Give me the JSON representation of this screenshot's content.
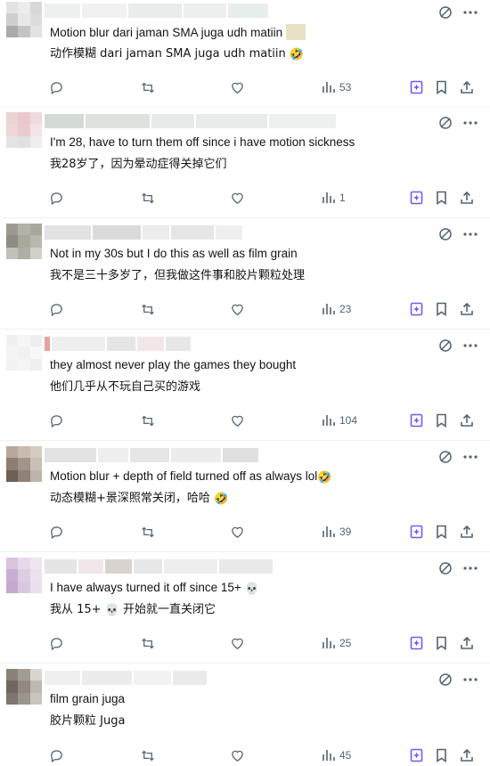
{
  "colors": {
    "text": "#0f1419",
    "secondary": "#536471",
    "grok": "#7856ff",
    "divider": "#eff3f4"
  },
  "icons": {
    "reply": "reply-icon",
    "retweet": "retweet-icon",
    "like": "heart-icon",
    "views": "views-icon",
    "grok": "grok-icon",
    "bookmark": "bookmark-icon",
    "share": "share-icon",
    "more": "more-icon"
  },
  "replies": [
    {
      "text_original": "Motion blur dari jaman SMA juga udh matiin",
      "text_translated": "动作模糊 dari jaman SMA juga udh matiin",
      "emoji": "🤣",
      "views": "53"
    },
    {
      "text_original": "I'm 28, have to turn them off since i have motion sickness",
      "text_translated": "我28岁了，因为晕动症得关掉它们",
      "views": "1"
    },
    {
      "text_original": "Not in my 30s but I do this as well as film grain",
      "text_translated": "我不是三十多岁了，但我做这件事和胶片颗粒处理",
      "views": "23"
    },
    {
      "text_original": "they almost never play the games they bought",
      "text_translated": "他们几乎从不玩自己买的游戏",
      "views": "104"
    },
    {
      "text_original": "Motion blur + depth of field turned off as always lol",
      "text_translated": "动态模糊+景深照常关闭，哈哈",
      "emoji": "🤣",
      "views": "39"
    },
    {
      "text_original": "I have always turned it off since 15+",
      "text_translated_a": "我从 15+",
      "text_translated_b": "开始就一直关闭它",
      "emoji": "💀",
      "views": "25"
    },
    {
      "text_original": "film grain juga",
      "text_translated": "胶片颗粒 Juga",
      "views": "45"
    }
  ]
}
